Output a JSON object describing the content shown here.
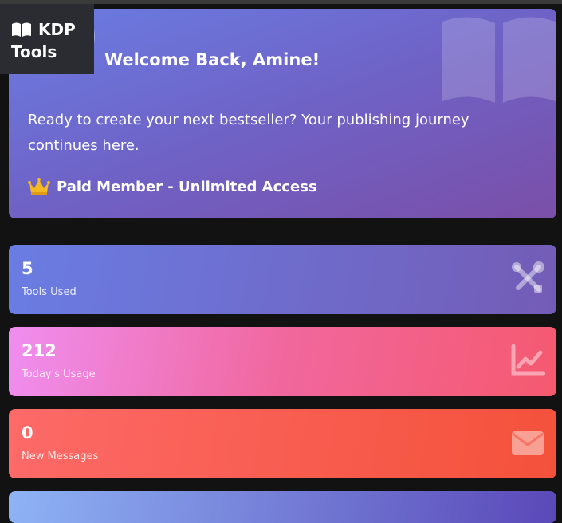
{
  "brand": {
    "line1": "KDP",
    "line2": "Tools",
    "icon": "book-open-icon"
  },
  "welcome": {
    "title": "Welcome Back, Amine!",
    "subtitle": "Ready to create your next bestseller? Your publishing journey continues here.",
    "membership": "Paid Member - Unlimited Access",
    "membership_icon": "crown-icon",
    "decoration_icon": "book-open-icon"
  },
  "stats": [
    {
      "value": "5",
      "label": "Tools Used",
      "icon": "tools-icon"
    },
    {
      "value": "212",
      "label": "Today's Usage",
      "icon": "chart-line-icon"
    },
    {
      "value": "0",
      "label": "New Messages",
      "icon": "envelope-icon"
    }
  ],
  "colors": {
    "background": "#121212",
    "welcome_gradient": [
      "#6a7de3",
      "#7a4fa8"
    ],
    "tools_card": [
      "#6a7de3",
      "#735cb6"
    ],
    "usage_card": [
      "#ef8ef0",
      "#f5596f"
    ],
    "messages_card": [
      "#fd6a68",
      "#f4513a"
    ],
    "crown": "#f5b921"
  }
}
